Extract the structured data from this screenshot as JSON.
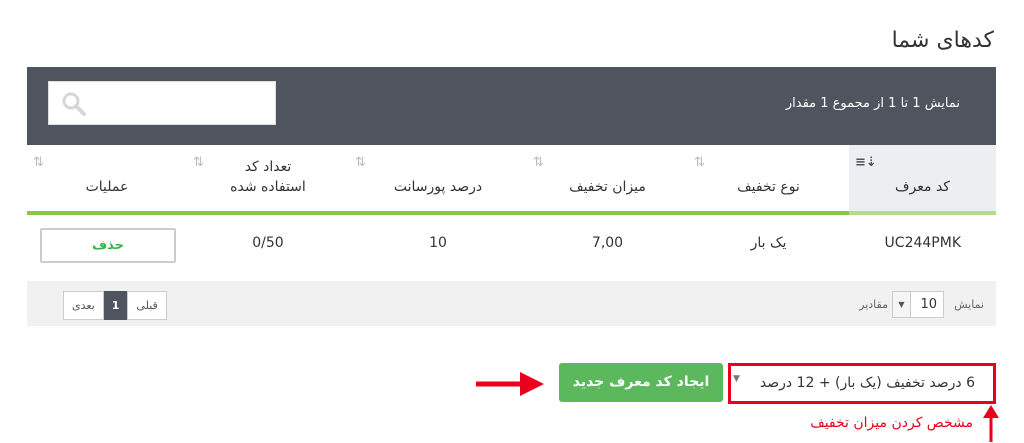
{
  "page": {
    "title": "کدهای شما"
  },
  "table": {
    "summary": "نمایش 1 تا 1 از مجموع 1 مقدار",
    "search": {
      "value": ""
    },
    "columns": [
      {
        "line1": "",
        "line2": "کد معرف"
      },
      {
        "line1": "",
        "line2": "نوع تخفیف"
      },
      {
        "line1": "",
        "line2": "میزان تخفیف"
      },
      {
        "line1": "",
        "line2": "درصد پورسانت"
      },
      {
        "line1": "تعداد کد",
        "line2": "استفاده شده"
      },
      {
        "line1": "",
        "line2": "عملیات"
      }
    ],
    "rows": [
      {
        "code": "UC244PMK",
        "type": "یک بار",
        "amount": "7,00",
        "commission": "10",
        "used": "0/50",
        "action": "حذف"
      }
    ]
  },
  "footer": {
    "show_label": "نمایش",
    "page_size": "10",
    "items_label": "مقادیر",
    "pager": {
      "prev": "قبلی",
      "current": "1",
      "next": "بعدی"
    }
  },
  "actions": {
    "create_label": "ایجاد کد معرف جدید",
    "discount_option": "6 درصد تخفیف (یک بار) + 12 درصد"
  },
  "annotation": {
    "text": "مشخص کردن میزان تخفیف"
  },
  "colors": {
    "header_bg": "#4f545f",
    "accent_green": "#8dc63f",
    "button_green": "#5cb85c",
    "annotation_red": "#e8001c"
  }
}
